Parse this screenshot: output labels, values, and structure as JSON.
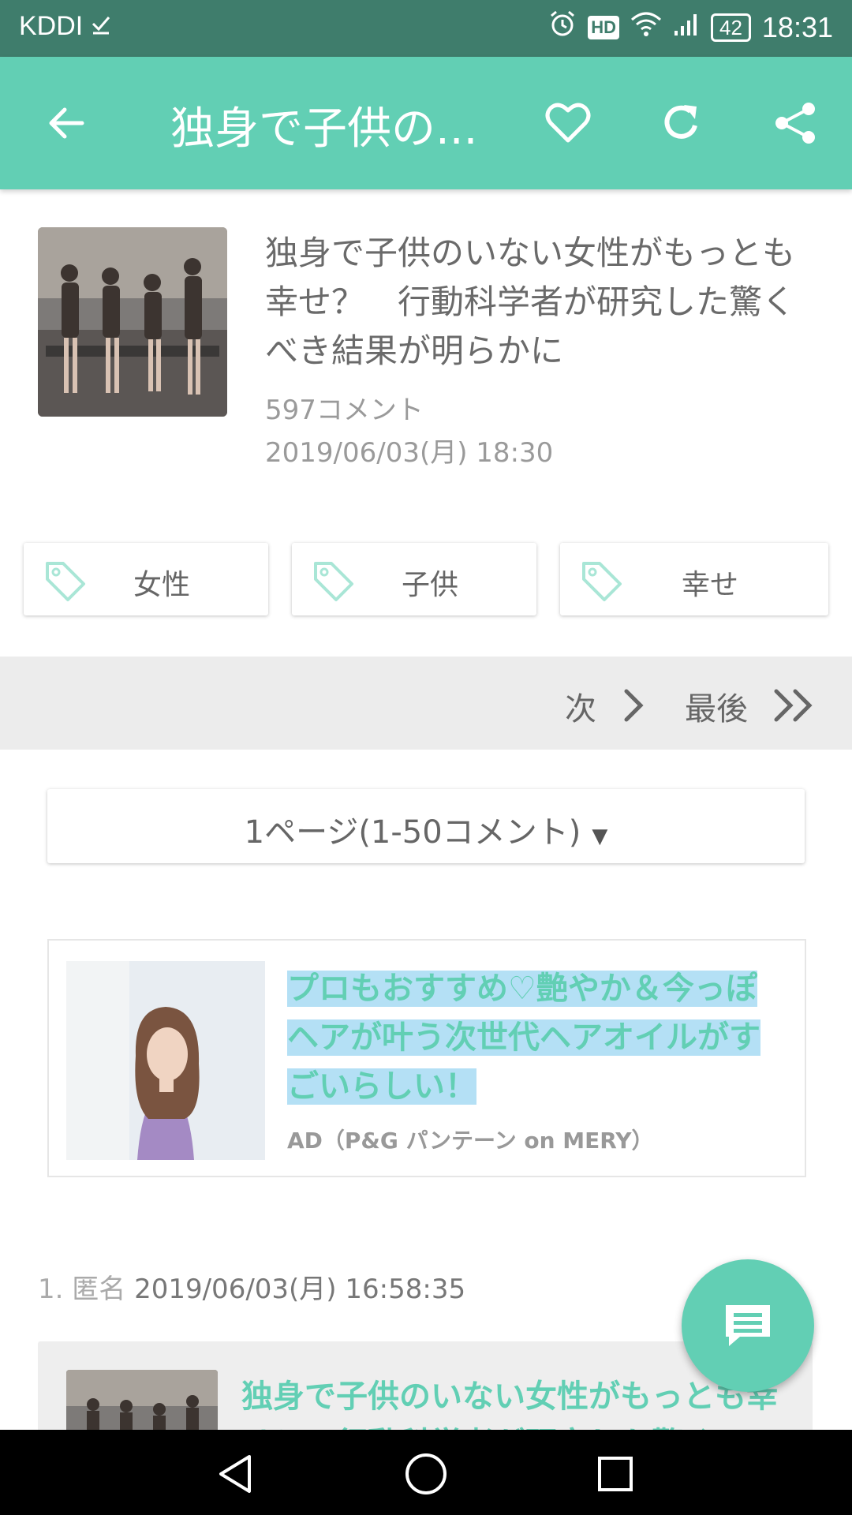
{
  "status_bar": {
    "carrier": "KDDI",
    "hd": "HD",
    "battery": "42",
    "time": "18:31"
  },
  "toolbar": {
    "title": "独身で子供の..."
  },
  "article": {
    "title": "独身で子供のいない女性がもっとも幸せ？　行動科学者が研究した驚くべき結果が明らかに",
    "comments": "597コメント",
    "date": "2019/06/03(月) 18:30"
  },
  "tags": [
    "女性",
    "子供",
    "幸せ"
  ],
  "pager": {
    "next": "次",
    "last": "最後"
  },
  "page_select": {
    "label": "1ページ(1-50コメント)",
    "caret": "▼"
  },
  "ad": {
    "title": "プロもおすすめ♡艶やか＆今っぽヘアが叶う次世代ヘアオイルがすごいらしい！",
    "source": "AD（P&G パンテーン on MERY）"
  },
  "comment": {
    "number": "1.",
    "name": "匿名",
    "date": "2019/06/03(月) 16:58:35",
    "link_text": "独身で子供のいない女性がもっとも幸せ？　行動科学者が研究した驚く"
  },
  "colors": {
    "accent": "#62cfb4",
    "status_bar": "#3f7d6c",
    "highlight": "#b4e0f5"
  }
}
